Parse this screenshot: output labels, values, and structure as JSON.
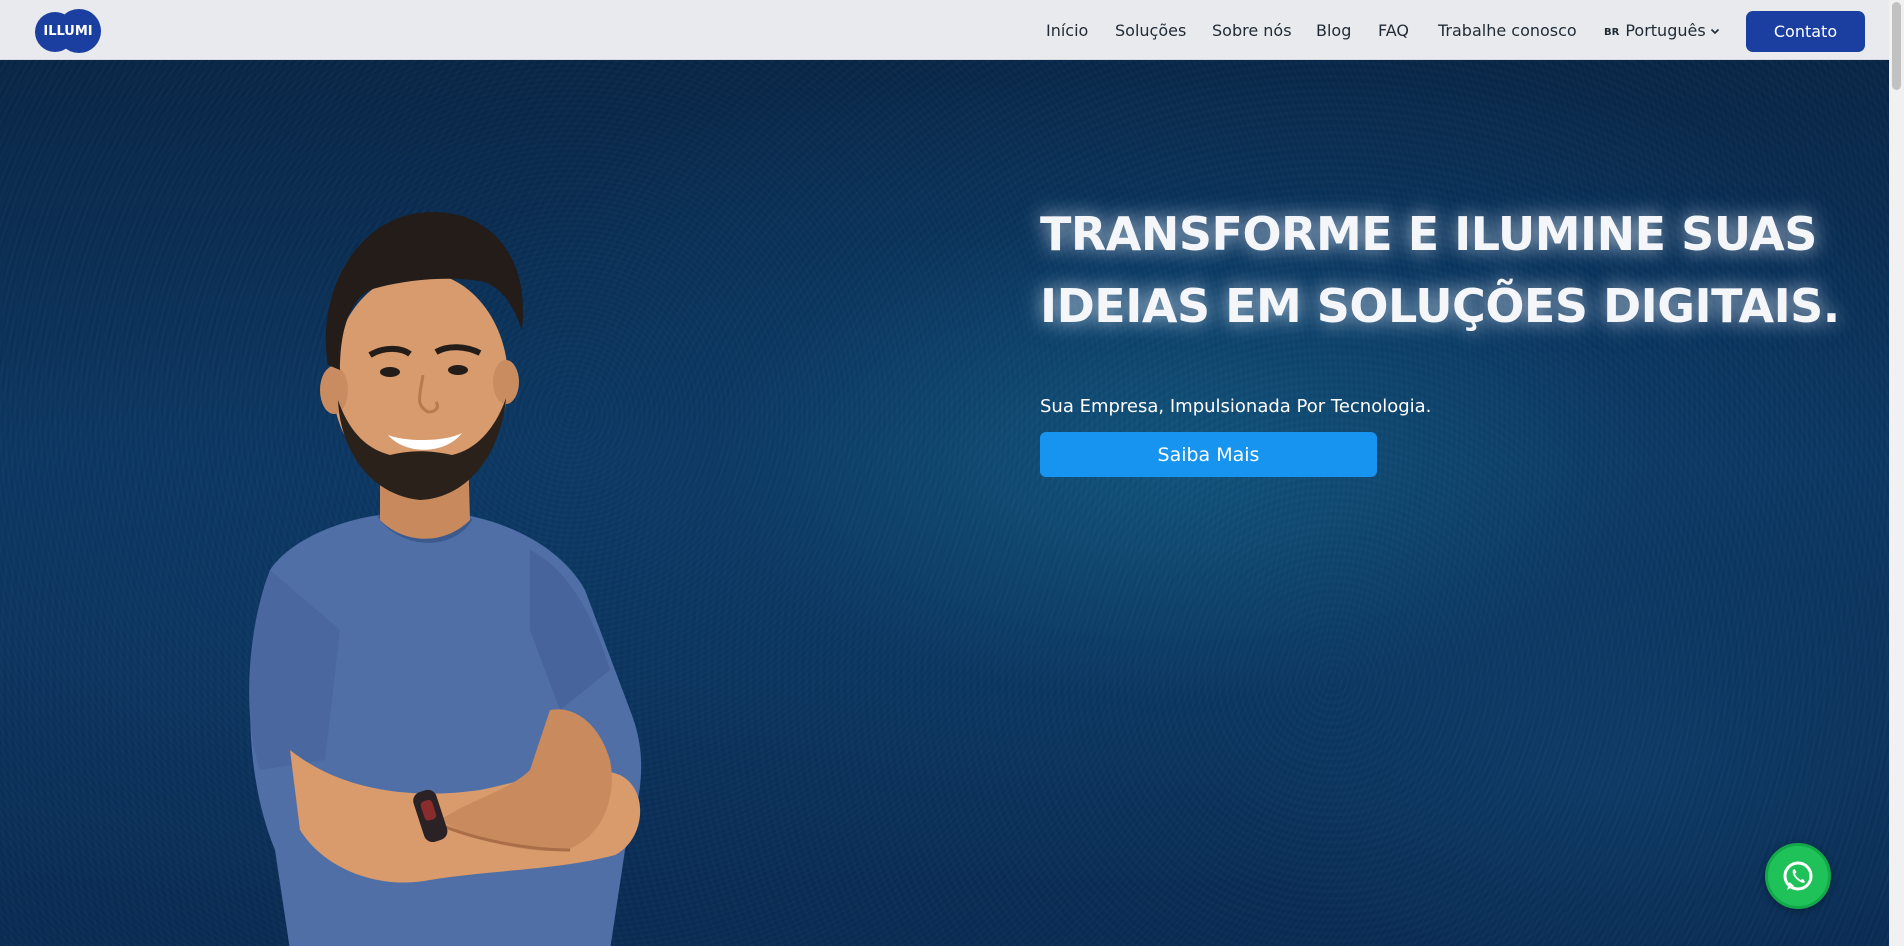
{
  "brand": {
    "logo_text": "ILLUMI",
    "color": "#1b3fa0"
  },
  "nav": {
    "links": [
      {
        "label": "Início"
      },
      {
        "label": "Soluções"
      },
      {
        "label": "Sobre nós"
      },
      {
        "label": "Blog"
      },
      {
        "label": "FAQ"
      },
      {
        "label": "Trabalhe conosco"
      }
    ],
    "language": {
      "flag": "BR",
      "label": "Português"
    },
    "contact_label": "Contato"
  },
  "hero": {
    "headline_line1": "TRANSFORME E ILUMINE SUAS",
    "headline_line2": "IDEIAS EM SOLUÇÕES DIGITAIS.",
    "subheadline": "Sua Empresa, Impulsionada Por Tecnologia.",
    "cta_label": "Saiba Mais",
    "cta_color": "#1793f0"
  },
  "floating": {
    "whatsapp_icon": "whatsapp-icon",
    "color": "#1fc259"
  }
}
